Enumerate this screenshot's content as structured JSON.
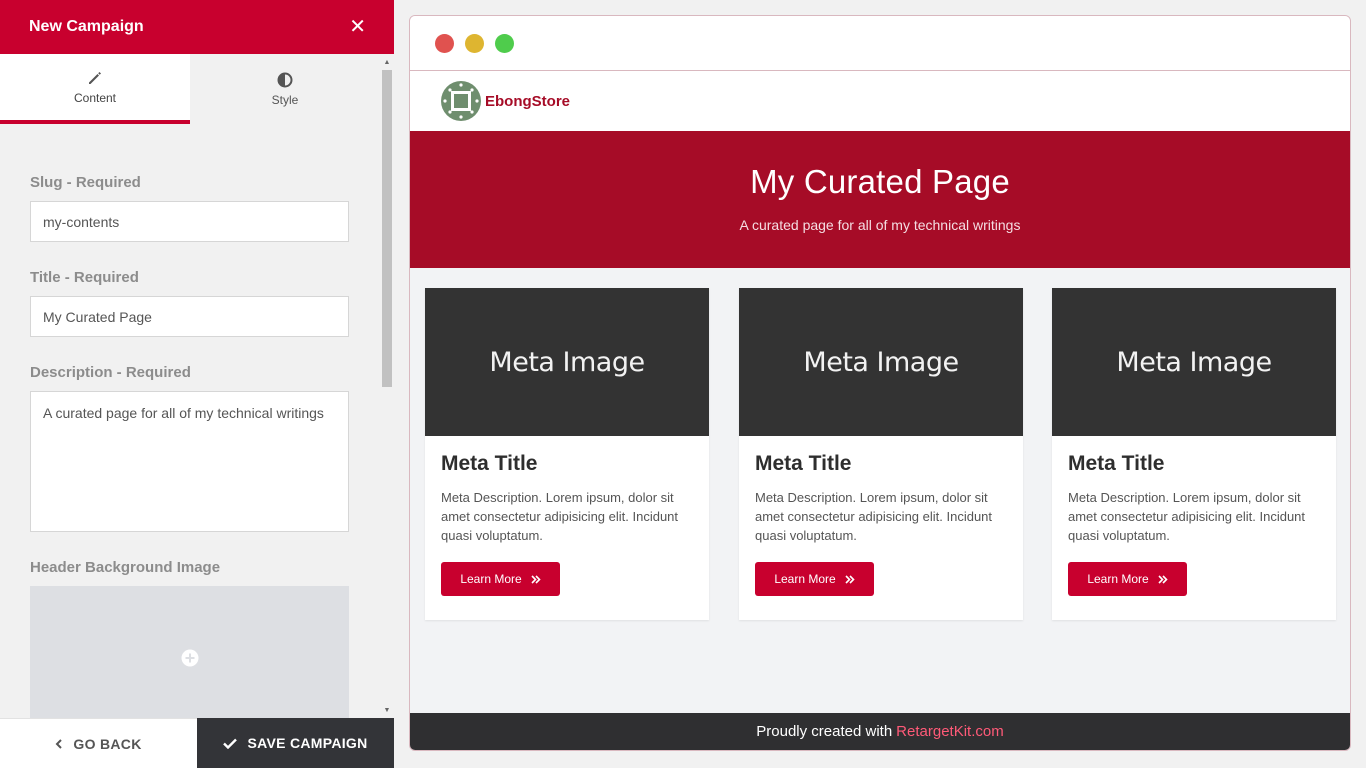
{
  "editor": {
    "title": "New Campaign",
    "tabs": [
      {
        "label": "Content",
        "icon": "pencil-icon",
        "active": true
      },
      {
        "label": "Style",
        "icon": "contrast-icon",
        "active": false
      }
    ],
    "fields": {
      "slug": {
        "label": "Slug - Required",
        "value": "my-contents"
      },
      "title": {
        "label": "Title - Required",
        "value": "My Curated Page"
      },
      "description": {
        "label": "Description - Required",
        "value": "A curated page for all of my technical writings"
      },
      "header_image": {
        "label": "Header Background Image"
      }
    },
    "buttons": {
      "back": "GO BACK",
      "save": "SAVE CAMPAIGN"
    }
  },
  "preview": {
    "brand": "EbongStore",
    "hero": {
      "title": "My Curated Page",
      "subtitle": "A curated page for all of my technical writings"
    },
    "cards": [
      {
        "image_text": "Meta Image",
        "title": "Meta Title",
        "description": "Meta Description. Lorem ipsum, dolor sit amet consectetur adipisicing elit. Incidunt quasi voluptatum.",
        "button": "Learn More"
      },
      {
        "image_text": "Meta Image",
        "title": "Meta Title",
        "description": "Meta Description. Lorem ipsum, dolor sit amet consectetur adipisicing elit. Incidunt quasi voluptatum.",
        "button": "Learn More"
      },
      {
        "image_text": "Meta Image",
        "title": "Meta Title",
        "description": "Meta Description. Lorem ipsum, dolor sit amet consectetur adipisicing elit. Incidunt quasi voluptatum.",
        "button": "Learn More"
      }
    ],
    "footer": {
      "text": "Proudly created with",
      "link": "RetargetKit.com"
    }
  },
  "colors": {
    "accent": "#c8002e",
    "hero_bg": "#a60c27",
    "dark": "#333438",
    "footer_link": "#ff5a78"
  }
}
